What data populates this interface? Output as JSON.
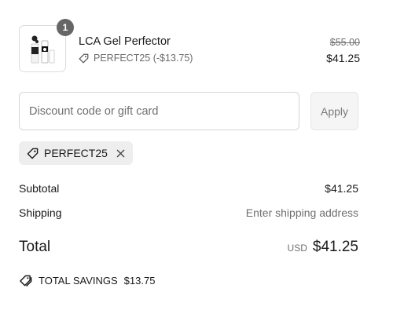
{
  "line_item": {
    "quantity": "1",
    "product_name": "LCA Gel Perfector",
    "discount_label": "PERFECT25 (-$13.75)",
    "original_price": "$55.00",
    "price": "$41.25"
  },
  "discount": {
    "placeholder": "Discount code or gift card",
    "value": "",
    "apply_label": "Apply",
    "applied_code": "PERFECT25"
  },
  "summary": {
    "subtotal_label": "Subtotal",
    "subtotal_value": "$41.25",
    "shipping_label": "Shipping",
    "shipping_value": "Enter shipping address",
    "total_label": "Total",
    "currency": "USD",
    "total_value": "$41.25",
    "savings_label": "TOTAL SAVINGS",
    "savings_value": "$13.75"
  },
  "icons": {
    "tag": "tag-icon",
    "remove": "close-icon",
    "savings": "tags-icon",
    "product": "product-image"
  },
  "colors": {
    "badge": "#666666",
    "muted": "#707070",
    "chip_bg": "#eeeeee"
  }
}
